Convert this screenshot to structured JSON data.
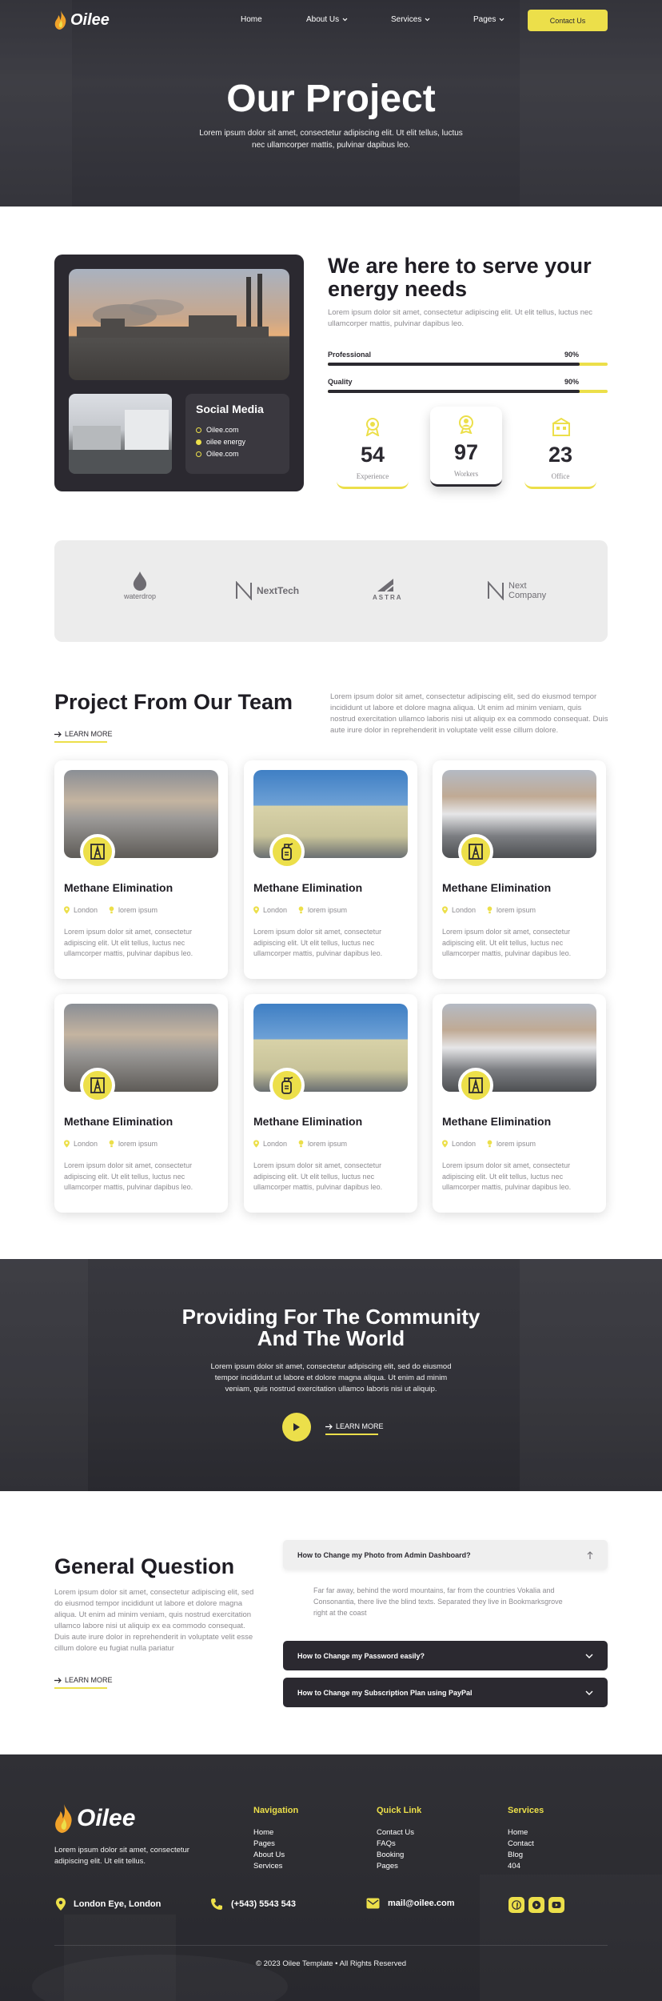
{
  "brand": {
    "name": "Oilee",
    "accent": "#ecdf4a",
    "dark": "#2b2930"
  },
  "nav": {
    "items": [
      {
        "label": "Home"
      },
      {
        "label": "About Us"
      },
      {
        "label": "Services"
      },
      {
        "label": "Pages"
      }
    ],
    "contact_label": "Contact Us"
  },
  "hero": {
    "title": "Our Project",
    "subtitle": "Lorem ipsum dolor sit amet, consectetur adipiscing elit. Ut elit tellus, luctus nec ullamcorper mattis, pulvinar dapibus leo."
  },
  "about": {
    "social_title": "Social Media",
    "social_items": [
      "Oilee.com",
      "oilee energy",
      "Oilee.com"
    ],
    "title": "We are here to serve your energy needs",
    "text": "Lorem ipsum dolor sit amet, consectetur adipiscing elit. Ut elit tellus, luctus nec ullamcorper mattis, pulvinar dapibus leo.",
    "skills": [
      {
        "label": "Professional",
        "value": "90%",
        "fraction": 0.9
      },
      {
        "label": "Quality",
        "value": "90%",
        "fraction": 0.9
      }
    ],
    "stats": [
      {
        "num": "54",
        "label": "Experience",
        "icon": "award-icon"
      },
      {
        "num": "97",
        "label": "Workers",
        "icon": "worker-badge-icon"
      },
      {
        "num": "23",
        "label": "Office",
        "icon": "office-building-icon"
      }
    ]
  },
  "partners": {
    "items": [
      {
        "name": "waterdrop",
        "icon": "drop-icon"
      },
      {
        "name": "NextTech",
        "icon": "n-mark-icon"
      },
      {
        "name": "ASTRA",
        "icon": "a-mark-icon"
      },
      {
        "name_line1": "Next",
        "name_line2": "Company",
        "icon": "n-mark-icon"
      }
    ]
  },
  "projects": {
    "title": "Project From Our Team",
    "learn_more": "LEARN MORE",
    "text": "Lorem ipsum dolor sit amet, consectetur adipiscing elit, sed do eiusmod tempor incididunt ut labore et dolore magna aliqua. Ut enim ad minim veniam, quis nostrud exercitation ullamco laboris nisi ut aliquip ex ea commodo consequat. Duis aute irure dolor in reprehenderit in voluptate velit esse cillum dolore.",
    "cards": [
      {
        "title": "Methane Elimination",
        "location": "London",
        "tag": "lorem ipsum",
        "desc": "Lorem ipsum dolor sit amet, consectetur adipiscing elit. Ut elit tellus, luctus nec ullamcorper mattis, pulvinar dapibus leo.",
        "icon": "oil-rig-icon"
      },
      {
        "title": "Methane Elimination",
        "location": "London",
        "tag": "lorem ipsum",
        "desc": "Lorem ipsum dolor sit amet, consectetur adipiscing elit. Ut elit tellus, luctus nec ullamcorper mattis, pulvinar dapibus leo.",
        "icon": "gas-canister-icon"
      },
      {
        "title": "Methane Elimination",
        "location": "London",
        "tag": "lorem ipsum",
        "desc": "Lorem ipsum dolor sit amet, consectetur adipiscing elit. Ut elit tellus, luctus nec ullamcorper mattis, pulvinar dapibus leo.",
        "icon": "oil-rig-icon"
      },
      {
        "title": "Methane Elimination",
        "location": "London",
        "tag": "lorem ipsum",
        "desc": "Lorem ipsum dolor sit amet, consectetur adipiscing elit. Ut elit tellus, luctus nec ullamcorper mattis, pulvinar dapibus leo.",
        "icon": "oil-rig-icon"
      },
      {
        "title": "Methane Elimination",
        "location": "London",
        "tag": "lorem ipsum",
        "desc": "Lorem ipsum dolor sit amet, consectetur adipiscing elit. Ut elit tellus, luctus nec ullamcorper mattis, pulvinar dapibus leo.",
        "icon": "gas-canister-icon"
      },
      {
        "title": "Methane Elimination",
        "location": "London",
        "tag": "lorem ipsum",
        "desc": "Lorem ipsum dolor sit amet, consectetur adipiscing elit. Ut elit tellus, luctus nec ullamcorper mattis, pulvinar dapibus leo.",
        "icon": "oil-rig-icon"
      }
    ]
  },
  "community": {
    "title_line1": "Providing For The Community",
    "title_line2": "And The World",
    "text": "Lorem ipsum dolor sit amet, consectetur adipiscing elit, sed do eiusmod tempor incididunt ut labore et dolore magna aliqua. Ut enim ad minim veniam, quis nostrud exercitation ullamco laboris nisi ut aliquip.",
    "learn_more": "LEARN MORE"
  },
  "faq": {
    "title": "General Question",
    "text": "Lorem ipsum dolor sit amet, consectetur adipiscing elit, sed do eiusmod tempor incididunt ut labore et dolore magna aliqua. Ut enim ad minim veniam, quis nostrud exercitation ullamco labore nisi ut aliquip ex ea commodo consequat. Duis aute irure dolor in reprehenderit in voluptate velit esse cillum dolore eu fugiat nulla pariatur",
    "learn_more": "LEARN MORE",
    "questions": [
      {
        "q": "How to Change my Photo from Admin Dashboard?",
        "open": true,
        "a": "Far far away, behind the word mountains, far from the countries Vokalia and Consonantia, there live the blind texts. Separated they live in Bookmarksgrove right at the coast"
      },
      {
        "q": "How to Change my Password easily?",
        "open": false
      },
      {
        "q": "How to Change my Subscription Plan using PayPal",
        "open": false
      }
    ]
  },
  "footer": {
    "desc": "Lorem ipsum dolor sit amet, consectetur adipiscing elit. Ut elit tellus.",
    "columns": [
      {
        "title": "Navigation",
        "links": [
          "Home",
          "Pages",
          "About Us",
          "Services"
        ]
      },
      {
        "title": "Quick Link",
        "links": [
          "Contact Us",
          "FAQs",
          "Booking",
          "Pages"
        ]
      },
      {
        "title": "Services",
        "links": [
          "Home",
          "Contact",
          "Blog",
          "404"
        ]
      }
    ],
    "address": "London Eye, London",
    "phone": "(+543) 5543 543",
    "email": "mail@oilee.com",
    "social": [
      "facebook-icon",
      "youtube-icon",
      "youtube-icon"
    ],
    "copyright": "© 2023 Oilee Template • All Rights Reserved"
  }
}
